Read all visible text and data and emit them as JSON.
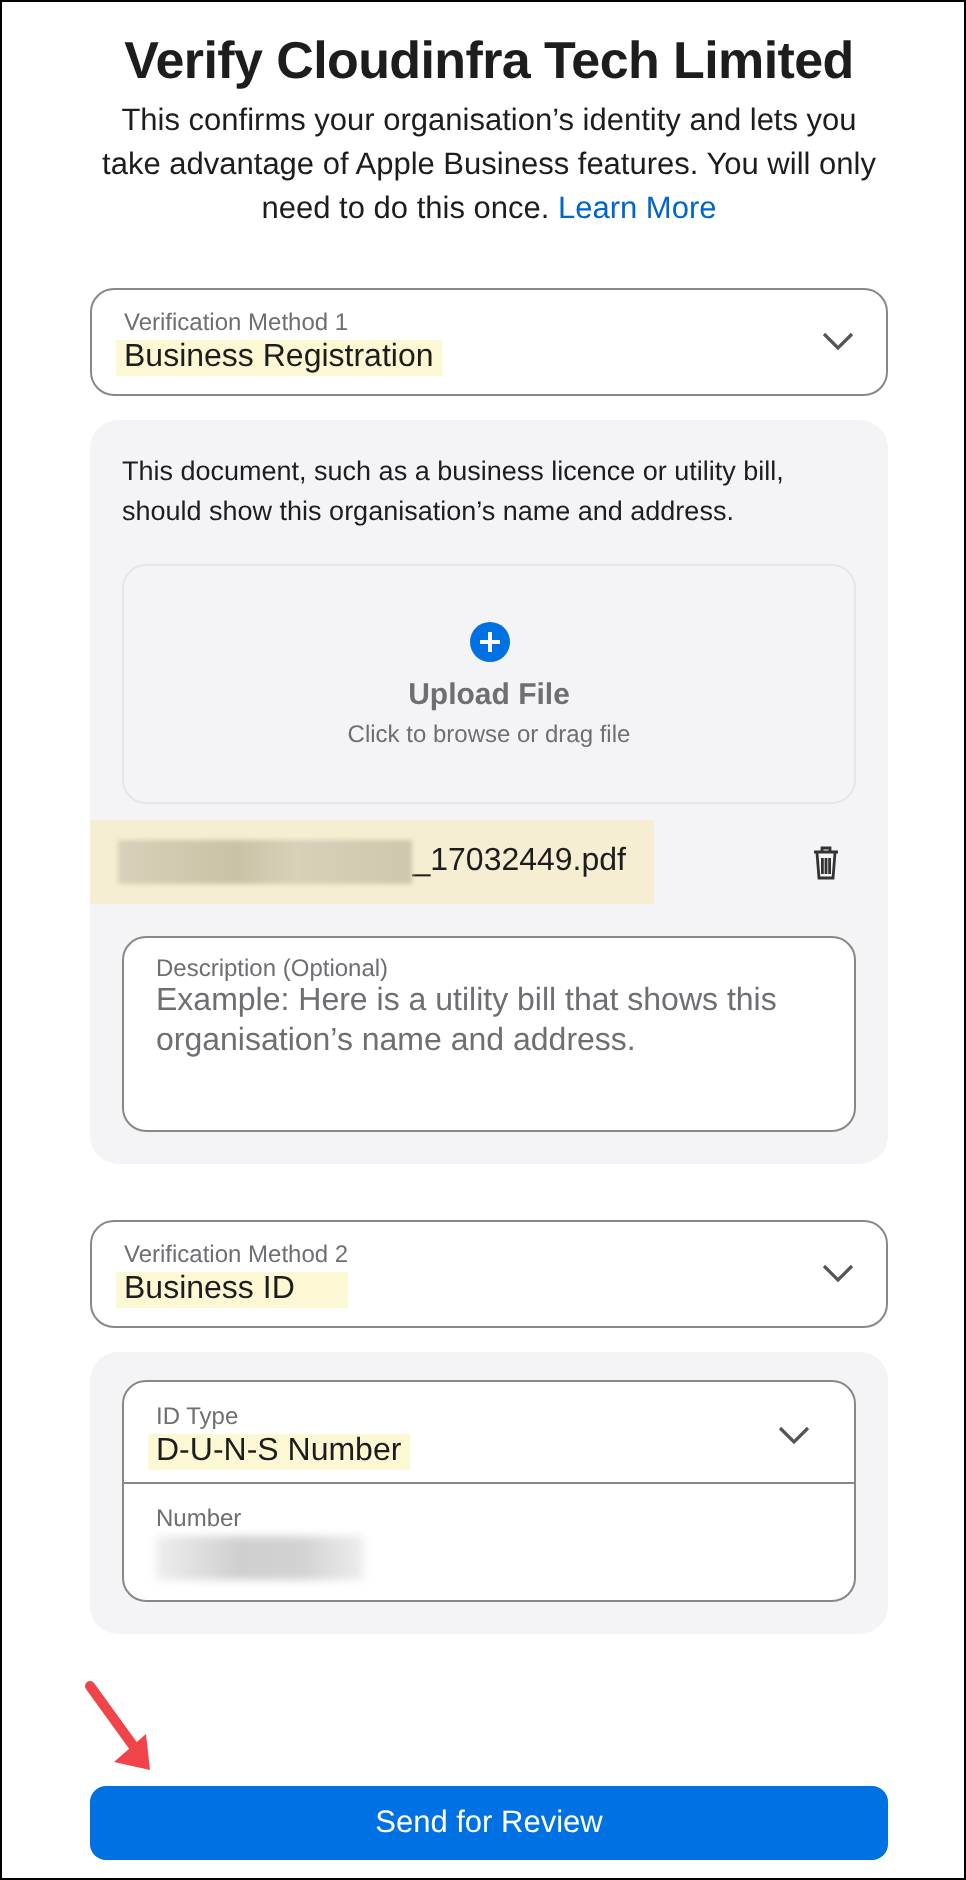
{
  "title": "Verify Cloudinfra Tech Limited",
  "intro": {
    "text": "This confirms your organisation’s identity and lets you take advantage of Apple Business features. You will only need to do this once.",
    "link": "Learn More"
  },
  "method_1": {
    "label": "Verification Method 1",
    "value": "Business Registration",
    "highlighted": true
  },
  "document_panel": {
    "note": "This document, such as a business licence or utility bill, should show this organisation’s name and address.",
    "upload": {
      "title": "Upload File",
      "hint": "Click to browse or drag file"
    },
    "file": {
      "name": "_17032449.pdf",
      "redacted": true,
      "highlighted": true
    },
    "description": {
      "label": "Description (Optional)",
      "placeholder": "Example: Here is a utility bill that shows this organisation’s name and address."
    }
  },
  "method_2": {
    "label": "Verification Method 2",
    "value": "Business ID",
    "highlighted": true
  },
  "id_panel": {
    "id_type": {
      "label": "ID Type",
      "value": "D-U-N-S Number",
      "highlighted": true
    },
    "number": {
      "label": "Number",
      "redacted": true
    }
  },
  "submit": "Send for Review"
}
